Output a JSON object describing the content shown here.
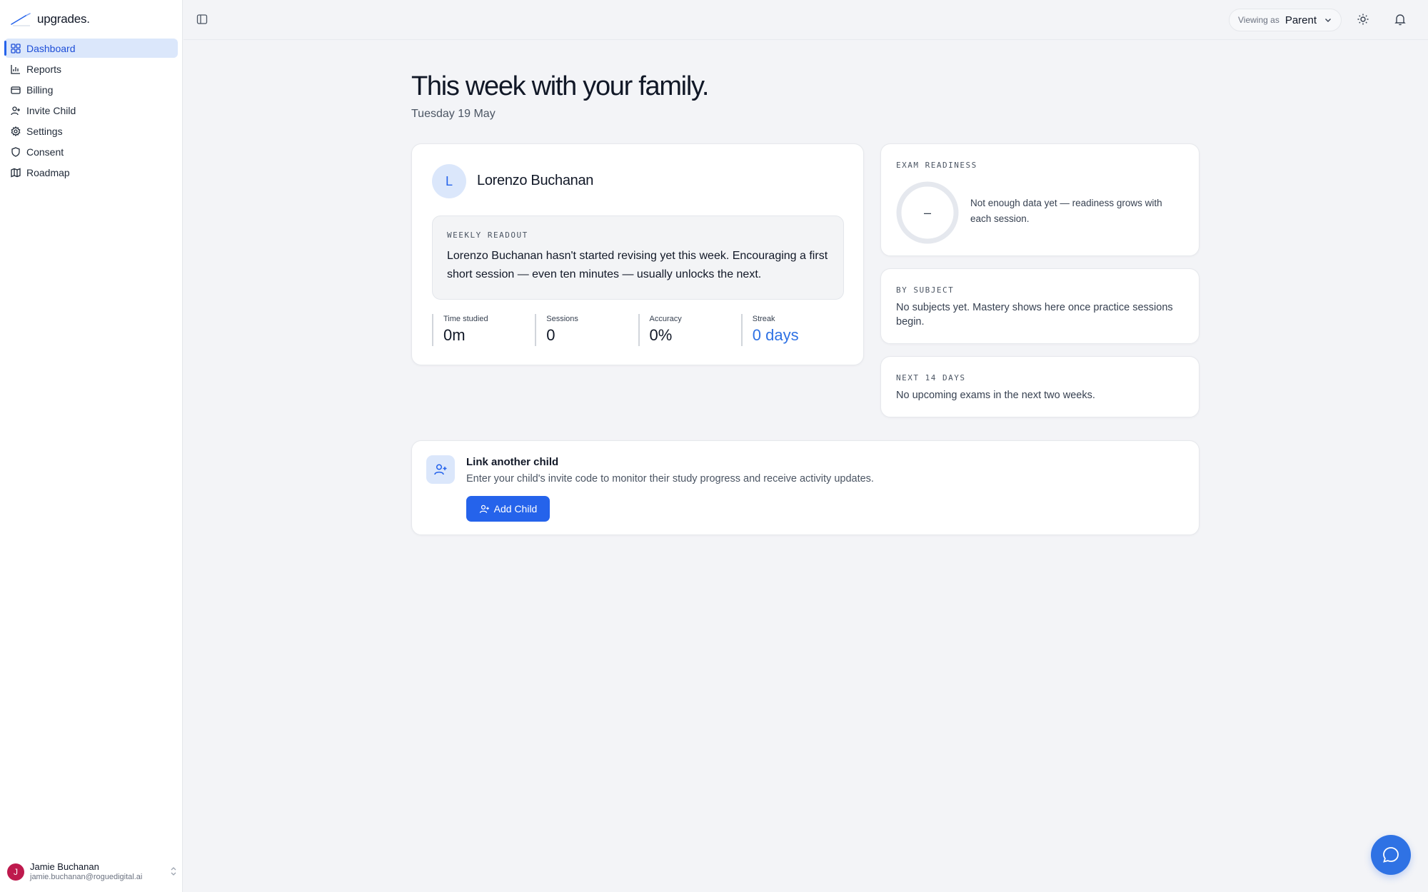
{
  "app": {
    "brand": "upgrades.",
    "accent": "#2563eb"
  },
  "sidebar": {
    "items": [
      {
        "label": "Dashboard",
        "icon": "grid-icon",
        "active": true
      },
      {
        "label": "Reports",
        "icon": "bar-chart-icon"
      },
      {
        "label": "Billing",
        "icon": "credit-card-icon"
      },
      {
        "label": "Invite Child",
        "icon": "user-plus-icon"
      },
      {
        "label": "Settings",
        "icon": "gear-icon"
      },
      {
        "label": "Consent",
        "icon": "shield-icon"
      },
      {
        "label": "Roadmap",
        "icon": "map-icon"
      }
    ],
    "user": {
      "initial": "J",
      "name": "Jamie Buchanan",
      "email": "jamie.buchanan@roguedigital.ai"
    }
  },
  "topbar": {
    "viewing_label": "Viewing as",
    "viewing_value": "Parent"
  },
  "main": {
    "title": "This week with your family.",
    "date": "Tuesday 19 May"
  },
  "child": {
    "initial": "L",
    "name": "Lorenzo Buchanan",
    "readout_title": "WEEKLY READOUT",
    "readout_text": "Lorenzo Buchanan hasn't started revising yet this week. Encouraging a first short session — even ten minutes — usually unlocks the next.",
    "stats": [
      {
        "label": "Time studied",
        "value": "0m"
      },
      {
        "label": "Sessions",
        "value": "0"
      },
      {
        "label": "Accuracy",
        "value": "0%"
      },
      {
        "label": "Streak",
        "value": "0 days"
      }
    ]
  },
  "exam": {
    "title": "EXAM READINESS",
    "value": "–",
    "text": "Not enough data yet — readiness grows with each session."
  },
  "subject": {
    "title": "BY SUBJECT",
    "text": "No subjects yet. Mastery shows here once practice sessions begin."
  },
  "next": {
    "title": "NEXT 14 DAYS",
    "text": "No upcoming exams in the next two weeks."
  },
  "link": {
    "title": "Link another child",
    "desc": "Enter your child's invite code to monitor their study progress and receive activity updates.",
    "button": "Add Child"
  }
}
